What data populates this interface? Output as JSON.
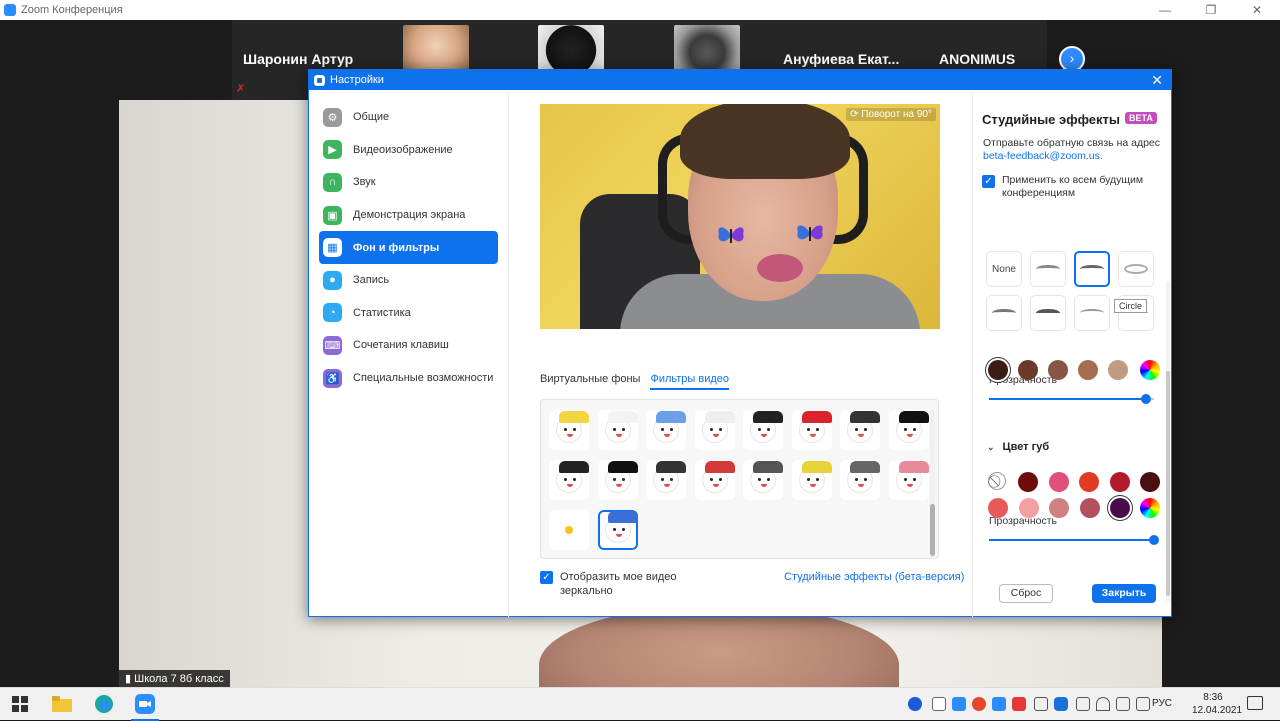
{
  "zoom_window": {
    "title": "Zoom Конференция",
    "participants": [
      "Шаронин Артур",
      "Ануфиева  Екат...",
      "ANONIMUS"
    ],
    "main_video_label": "Школа 7 8б класс"
  },
  "settings": {
    "title": "Настройки",
    "nav": [
      {
        "label": "Общие",
        "icon": "gear-icon",
        "color": "#9a9a9a"
      },
      {
        "label": "Видеоизображение",
        "icon": "video-icon",
        "color": "#3cb55e"
      },
      {
        "label": "Звук",
        "icon": "headphones-icon",
        "color": "#3cb55e"
      },
      {
        "label": "Демонстрация экрана",
        "icon": "share-screen-icon",
        "color": "#3cb55e"
      },
      {
        "label": "Фон и фильтры",
        "icon": "background-icon",
        "color": "#0e72ed"
      },
      {
        "label": "Запись",
        "icon": "record-icon",
        "color": "#2eaaf5"
      },
      {
        "label": "Статистика",
        "icon": "statistics-icon",
        "color": "#2eaaf5"
      },
      {
        "label": "Сочетания клавиш",
        "icon": "keyboard-icon",
        "color": "#8b6ad6"
      },
      {
        "label": "Специальные возможности",
        "icon": "accessibility-icon",
        "color": "#8b6ad6"
      }
    ],
    "active_nav": "Фон и фильтры",
    "preview": {
      "rotate_label": "Поворот на 90°"
    },
    "tabs": [
      "Виртуальные фоны",
      "Фильтры видео"
    ],
    "active_tab": "Фильтры видео",
    "mirror_label": "Отобразить мое видео зеркально",
    "studio_link": "Студийные эффекты (бета-версия)",
    "studio": {
      "title": "Студийные эффекты",
      "badge": "BETA",
      "feedback_text": "Отправьте обратную связь на адрес",
      "feedback_email": "beta-feedback@zoom.us.",
      "apply_all": "Применить ко всем будущим конференциям",
      "eyebrow_none": "None",
      "tooltip": "Circle",
      "opacity_label": "Прозрачность",
      "brow_opacity": 0.95,
      "lip_color_label": "Цвет губ",
      "lip_opacity": 1.0,
      "reset_button": "Сброс",
      "close_button": "Закрыть",
      "brow_colors": [
        "#3b1d14",
        "#6b3a2a",
        "#875644",
        "#a56d52",
        "#c09a82"
      ],
      "lip_colors_row1": [
        "#6e0b0b",
        "#e0507a",
        "#e23a25",
        "#b21a2c",
        "#4a1010"
      ],
      "lip_colors_row2": [
        "#e85a5a",
        "#f4a0a3",
        "#d08080",
        "#b34f5f",
        "#4a0b4a"
      ]
    }
  },
  "taskbar": {
    "language": "РУС",
    "time": "8:36",
    "date": "12.04.2021"
  }
}
